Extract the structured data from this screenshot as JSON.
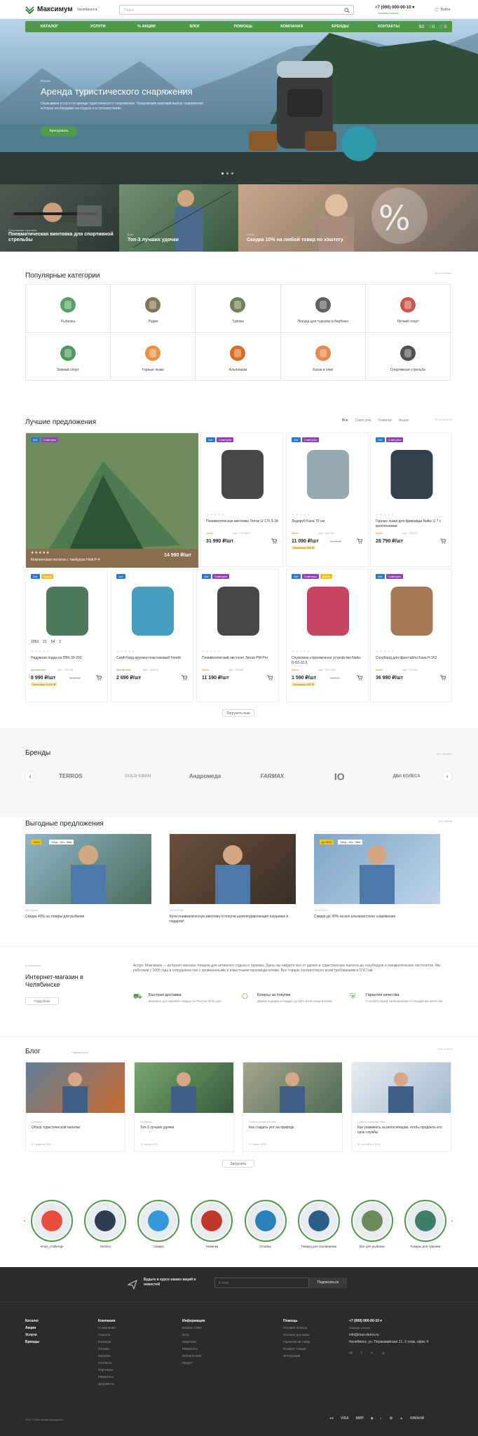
{
  "header": {
    "logo": "Максимум",
    "city": "Челябинск ▾",
    "search_placeholder": "Поиск",
    "phone": "+7 (000) 000-00-10 ▾",
    "callback": "Заказать звонок",
    "login": "Войти"
  },
  "nav": {
    "items": [
      "Каталог",
      "Услуги",
      "% Акции",
      "Блог",
      "Помощь",
      "Компания",
      "Бренды",
      "Контакты"
    ],
    "compare": "0",
    "fav": "0",
    "cart": "0"
  },
  "hero": {
    "label": "Услуги",
    "title": "Аренда туристического снаряжения",
    "desc": "Оказываем услуги по аренде туристического снаряжения. Предлагаем широкий выбор снаряжения, которое необходимо на отдыхе и в путешествиях.",
    "button": "Арендовать"
  },
  "banners": [
    {
      "tag": "Спортивная стрельба",
      "caption": "Пневматическая винтовка для спортивной стрельбы"
    },
    {
      "tag": "Блог",
      "caption": "Топ-3 лучших удочки"
    },
    {
      "tag": "Акция",
      "caption": "Скидка 10% на любой товар по хэштегу"
    }
  ],
  "categories": {
    "title": "Популярные категории",
    "all": "Весь каталог",
    "items": [
      "Рыбалка",
      "Лодки",
      "Туризм",
      "Посуда для туризма и барбекю",
      "Летний спорт",
      "Зимний спорт",
      "Горные лыжи",
      "Альпинизм",
      "Каски и очки",
      "Спортивная стрельба"
    ]
  },
  "offers": {
    "title": "Лучшие предложения",
    "all": "Весь каталог",
    "tabs": [
      "Все",
      "Советуем",
      "Новинки",
      "Акции"
    ],
    "load_more": "Загрузить еще",
    "products": [
      {
        "name": "Кемпинговая палатка с тамбуром Holb P-4",
        "price": "14 990 ₽/шт",
        "badges": [
          "Хит",
          "Советуем"
        ]
      },
      {
        "name": "Пневматическая винтовка Terras U-176 S 2й",
        "price": "31 990 ₽/шт",
        "avail": "Мало",
        "art": "Арт: 1703640",
        "badges": [
          "Хит",
          "Советуем"
        ]
      },
      {
        "name": "Ледоруб Kasa 70 см",
        "price": "11 090 ₽/шт",
        "old": "11 990 ₽",
        "avail": "Мало",
        "art": "Арт: 184703",
        "save": "Экономия 900 ₽",
        "badges": [
          "Хит",
          "Советуем"
        ]
      },
      {
        "name": "Горные лыжи для фрирайда Nalks U 7 с креплениями",
        "price": "28 790 ₽/шт",
        "avail": "Мало",
        "art": "Арт: 738910",
        "badges": [
          "Хит",
          "Советуем"
        ]
      },
      {
        "name": "Надувная лодка из ПВХ 30-200",
        "price": "8 990 ₽/шт",
        "old": "11 990 ₽",
        "avail": "Достаточно",
        "art": "Арт: 755136",
        "save": "Экономия 3 000 ₽",
        "badges": [
          "Хит",
          "Акция"
        ],
        "timer": [
          "1053",
          "21",
          "54",
          "2"
        ]
      },
      {
        "name": "Скейтборд-круизер пластиковый Freeld",
        "price": "2 690 ₽/шт",
        "avail": "Достаточно",
        "art": "Арт: 184073",
        "badges": [
          "Хит"
        ]
      },
      {
        "name": "Пневматический пистолет Terras PM Pro",
        "price": "11 190 ₽/шт",
        "avail": "Мало",
        "art": "Арт: 104087",
        "badges": [
          "Хит",
          "Советуем"
        ]
      },
      {
        "name": "Спусковое страховочное устройство Nalks D-63-10.5",
        "price": "1 590 ₽/шт",
        "old": "1 990 ₽",
        "avail": "Мало",
        "art": "Арт: 138740а",
        "save": "Экономия 400 ₽",
        "badges": [
          "Хит",
          "Советуем",
          "Акция"
        ]
      },
      {
        "name": "Сноуборд для фристайла Kasa H 162",
        "price": "36 990 ₽/шт",
        "avail": "Мало",
        "art": "Арт: 1749bs",
        "badges": [
          "Хит",
          "Советуем"
        ]
      }
    ]
  },
  "brands": {
    "title": "Бренды",
    "all": "Все бренды",
    "items": [
      "TERROS",
      "GOLD SWAN",
      "Андромеда",
      "FARMAX",
      "IO",
      "ДВА КОЛЕСА"
    ]
  },
  "promos": {
    "title": "Выгодные предложения",
    "all": "Все акции",
    "items": [
      {
        "badge": "-40%",
        "timer": "116д : 14ч : 38м",
        "date": "Без срока",
        "text": "Скидка 40% на товары для рыбалки"
      },
      {
        "badge": "",
        "timer": "",
        "date": "14.04.2021",
        "text": "Купи пневматическую винтовку и получи шумоподавляющие наушники в подарок!"
      },
      {
        "badge": "до 30%",
        "timer": "116д : 15ч : 38м",
        "date": "14.04.2021",
        "text": "Скидка до 30% на все альпинистское снаряжение"
      }
    ]
  },
  "about": {
    "label": "О компании",
    "title": "Интернет-магазин в Челябинске",
    "btn": "Подробнее",
    "text": "Аспро: Максимум — интернет-магазин товаров для активного отдыха и туризма. Здесь вы найдете все от удочек и туристических палаток до сноубордов и пневматических пистолетов. Мы работаем с 2005 года в сотрудничестве с проверенными и известными производителями. Все товары соответствуют всем требованиям и ГОСТам.",
    "features": [
      {
        "t": "Быстрая доставка",
        "d": "Бережно доставляем товары по России за 3х дня"
      },
      {
        "t": "Бонусы за покупки",
        "d": "Дарим подарки и скидки до 10% всем покупателям"
      },
      {
        "t": "Гарантия качества",
        "d": "Соответствуем требованиям и стандартам качества"
      }
    ]
  },
  "blog": {
    "title": "Блог",
    "subscribe": "Подписаться",
    "all": "Все статьи",
    "load": "Загрузить",
    "items": [
      {
        "cat": "Палатки",
        "title": "Обзор туристической палатки",
        "date": "07 апреля 2021"
      },
      {
        "cat": "Рыбалка",
        "title": "Топ-3 лучших удочки",
        "date": "17 марта 2021"
      },
      {
        "cat": "Советы покупателям",
        "title": "Как создать уют на природе",
        "date": "01 июня 2020"
      },
      {
        "cat": "Советы покупателям",
        "title": "Как ухаживать за велосипедом, чтобы продлить его срок службы",
        "date": "30 сентября 2019"
      }
    ]
  },
  "stories": [
    "#max_challenge",
    "Оплата",
    "Скидки",
    "Новинки",
    "Отзывы",
    "Товары для альпинизма",
    "Все для рыбалки",
    "Товары для туризма"
  ],
  "footer": {
    "sub_text": "Будьте в курсе наших акций и новостей",
    "email_placeholder": "E-mail",
    "sub_btn": "Подписаться",
    "cols": [
      {
        "h": [
          "Каталог",
          "Акции",
          "Услуги",
          "Бренды"
        ],
        "items": []
      },
      {
        "h": [
          "Компания"
        ],
        "items": [
          "О компании",
          "Новости",
          "Команда",
          "Отзывы",
          "Карьера",
          "Контакты",
          "Партнеры",
          "Реквизиты",
          "Документы"
        ]
      },
      {
        "h": [
          "Информация"
        ],
        "items": [
          "Вопрос-ответ",
          "Блог",
          "Лицензии",
          "Реквизиты",
          "Безналичная",
          "Кредит"
        ]
      },
      {
        "h": [
          "Помощь"
        ],
        "items": [
          "Условия оплаты",
          "Условия доставки",
          "Гарантия на товар",
          "Возврат товара",
          "Инструкции"
        ]
      }
    ],
    "phone": "+7 (000) 000-00-10 ▾",
    "callback": "Заказать звонок",
    "email": "info@max-demo.ru",
    "address": "Челябинск, ул. Первомайская 21, 3 этаж, офис 4",
    "copy": "2021 © Все права защищены",
    "payments": [
      "VISA",
      "МИР",
      "",
      "",
      "",
      "",
      "ЮМАНИ"
    ]
  }
}
